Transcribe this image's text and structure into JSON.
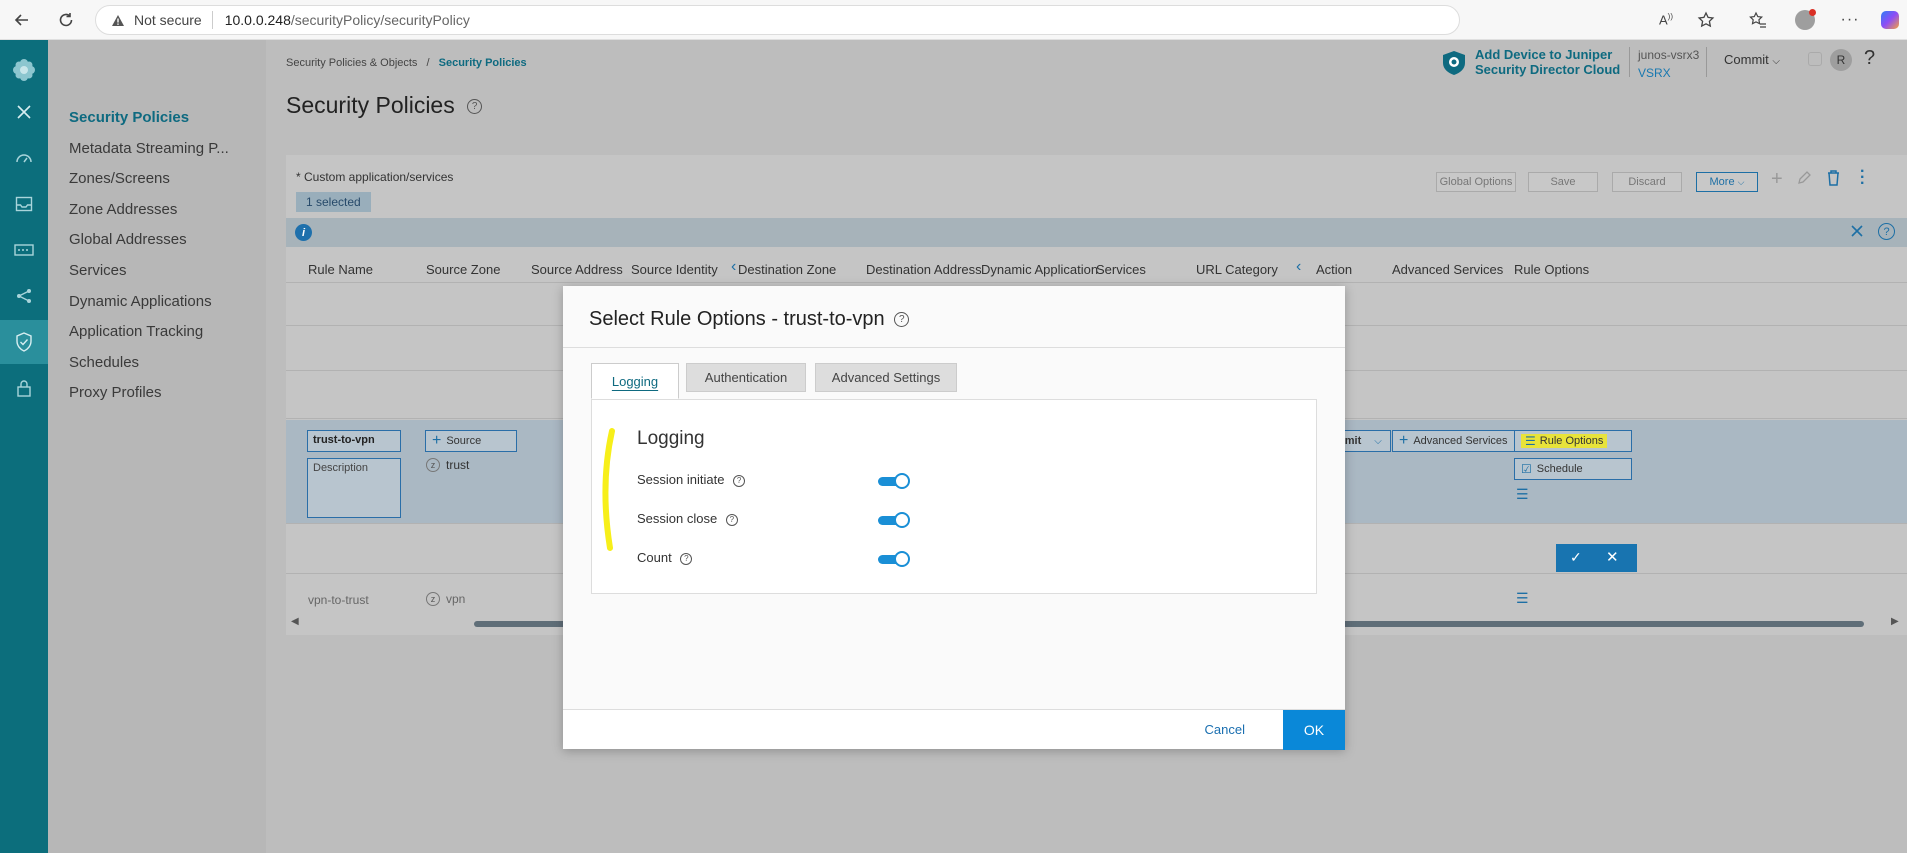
{
  "browser": {
    "not_secure": "Not secure",
    "url_host": "10.0.0.248",
    "url_path": "/securityPolicy/securityPolicy"
  },
  "sidemenu": {
    "items": [
      {
        "label": "Security Policies"
      },
      {
        "label": "Metadata Streaming P..."
      },
      {
        "label": "Zones/Screens"
      },
      {
        "label": "Zone Addresses"
      },
      {
        "label": "Global Addresses"
      },
      {
        "label": "Services"
      },
      {
        "label": "Dynamic Applications"
      },
      {
        "label": "Application Tracking"
      },
      {
        "label": "Schedules"
      },
      {
        "label": "Proxy Profiles"
      }
    ]
  },
  "header": {
    "breadcrumb_root": "Security Policies & Objects",
    "breadcrumb_sep": "/",
    "breadcrumb_current": "Security Policies",
    "page_title": "Security Policies",
    "sd_line1": "Add Device to Juniper",
    "sd_line2": "Security Director Cloud",
    "device_name": "junos-vsrx3",
    "device_type": "VSRX",
    "commit": "Commit",
    "avatar": "R",
    "help": "?"
  },
  "panel": {
    "custom_note": "* Custom application/services",
    "selected": "1 selected",
    "toolbar": {
      "global_options": "Global Options",
      "save": "Save",
      "discard": "Discard",
      "more": "More"
    },
    "columns": [
      "Rule Name",
      "Source Zone",
      "Source Address",
      "Source Identity",
      "Destination Zone",
      "Destination Address",
      "Dynamic Application",
      "Services",
      "URL Category",
      "Action",
      "Advanced Services",
      "Rule Options"
    ],
    "edit_row": {
      "rule_name": "trust-to-vpn",
      "description": "Description",
      "source_btn": "Source",
      "zone": "trust",
      "dash": "—",
      "permit": "Permit",
      "advanced_services": "Advanced Services",
      "rule_options": "Rule Options",
      "schedule": "Schedule"
    },
    "row2": {
      "rule_name": "vpn-to-trust",
      "zone": "vpn",
      "dash": "—"
    }
  },
  "modal": {
    "title": "Select Rule Options - trust-to-vpn",
    "tabs": [
      {
        "label": "Logging"
      },
      {
        "label": "Authentication"
      },
      {
        "label": "Advanced Settings"
      }
    ],
    "section_title": "Logging",
    "options": [
      {
        "label": "Session initiate",
        "on": true
      },
      {
        "label": "Session close",
        "on": true
      },
      {
        "label": "Count",
        "on": true
      }
    ],
    "cancel": "Cancel",
    "ok": "OK"
  },
  "colors": {
    "rail": "#0c6e7c",
    "accent": "#0e6a80",
    "primary_button": "#0a88d8",
    "highlight": "#f7ef1a"
  }
}
